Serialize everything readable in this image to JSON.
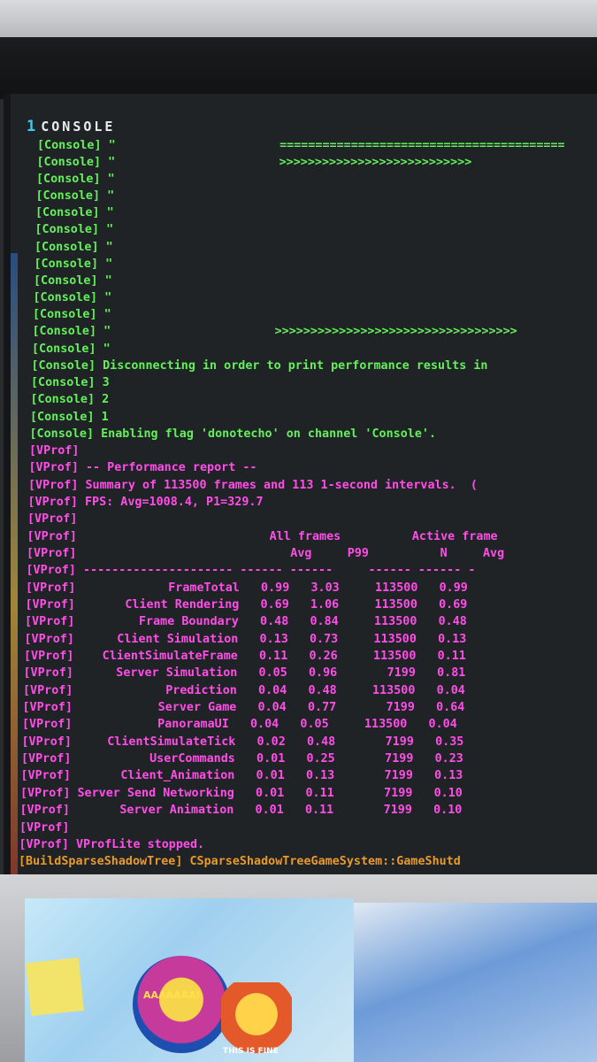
{
  "console": {
    "tab_number": "1",
    "title": "CONSOLE",
    "lines": [
      {
        "text": "[Console] \"                       ========================================",
        "color": "green"
      },
      {
        "text": "[Console] \"                       >>>>>>>>>>>>>>>>>>>>>>>>>>>",
        "color": "green"
      },
      {
        "text": "[Console] \"",
        "color": "green"
      },
      {
        "text": "[Console] \"",
        "color": "green"
      },
      {
        "text": "[Console] \"",
        "color": "green"
      },
      {
        "text": "[Console] \"",
        "color": "green"
      },
      {
        "text": "[Console] \"",
        "color": "green"
      },
      {
        "text": "[Console] \"",
        "color": "green"
      },
      {
        "text": "[Console] \"",
        "color": "green"
      },
      {
        "text": "[Console] \"",
        "color": "green"
      },
      {
        "text": "[Console] \"",
        "color": "green"
      },
      {
        "text": "[Console] \"                       >>>>>>>>>>>>>>>>>>>>>>>>>>>>>>>>>>",
        "color": "green"
      },
      {
        "text": "[Console] \"",
        "color": "green"
      },
      {
        "text": "[Console] Disconnecting in order to print performance results in",
        "color": "green"
      },
      {
        "text": "[Console] 3",
        "color": "green"
      },
      {
        "text": "[Console] 2",
        "color": "green"
      },
      {
        "text": "[Console] 1",
        "color": "green"
      },
      {
        "text": "[Console] Enabling flag 'donotecho' on channel 'Console'.",
        "color": "green"
      },
      {
        "text": "[VProf]",
        "color": "pink"
      },
      {
        "text": "[VProf] -- Performance report --",
        "color": "pink"
      },
      {
        "text": "[VProf] Summary of 113500 frames and 113 1-second intervals.  (",
        "color": "pink"
      },
      {
        "text": "[VProf] FPS: Avg=1008.4, P1=329.7",
        "color": "pink"
      },
      {
        "text": "[VProf]",
        "color": "pink"
      },
      {
        "text": "[VProf]                           All frames          Active frame",
        "color": "pink"
      },
      {
        "text": "[VProf]                              Avg     P99          N     Avg",
        "color": "pink"
      },
      {
        "text": "[VProf] --------------------- ------ ------     ------ ------ -",
        "color": "pink"
      },
      {
        "text": "[VProf]             FrameTotal   0.99   3.03     113500   0.99",
        "color": "pink"
      },
      {
        "text": "[VProf]       Client Rendering   0.69   1.06     113500   0.69",
        "color": "pink"
      },
      {
        "text": "[VProf]         Frame Boundary   0.48   0.84     113500   0.48",
        "color": "pink"
      },
      {
        "text": "[VProf]      Client Simulation   0.13   0.73     113500   0.13",
        "color": "pink"
      },
      {
        "text": "[VProf]    ClientSimulateFrame   0.11   0.26     113500   0.11",
        "color": "pink"
      },
      {
        "text": "[VProf]      Server Simulation   0.05   0.96       7199   0.81",
        "color": "pink"
      },
      {
        "text": "[VProf]             Prediction   0.04   0.48     113500   0.04",
        "color": "pink"
      },
      {
        "text": "[VProf]            Server Game   0.04   0.77       7199   0.64",
        "color": "pink"
      },
      {
        "text": "[VProf]            PanoramaUI   0.04   0.05     113500   0.04",
        "color": "pink"
      },
      {
        "text": "[VProf]     ClientSimulateTick   0.02   0.48       7199   0.35",
        "color": "pink"
      },
      {
        "text": "[VProf]           UserCommands   0.01   0.25       7199   0.23",
        "color": "pink"
      },
      {
        "text": "[VProf]       Client_Animation   0.01   0.13       7199   0.13",
        "color": "pink"
      },
      {
        "text": "[VProf] Server Send Networking   0.01   0.11       7199   0.10",
        "color": "pink"
      },
      {
        "text": "[VProf]       Server Animation   0.01   0.11       7199   0.10",
        "color": "pink"
      },
      {
        "text": "[VProf]",
        "color": "pink"
      },
      {
        "text": "[VProf] VProfLite stopped.",
        "color": "pink"
      },
      {
        "text": "[BuildSparseShadowTree] CSparseShadowTreeGameSystem::GameShutd",
        "color": "orange"
      }
    ]
  },
  "colors": {
    "green": "#63f05a",
    "pink": "#ff4de8",
    "orange": "#e89a2c",
    "header_number": "#46c6e9"
  },
  "stickers": {
    "mascot_text": "AAAAAAA!",
    "fire_text": "THIS IS FINE"
  }
}
